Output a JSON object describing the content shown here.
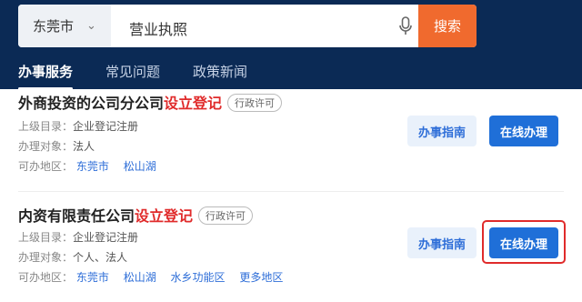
{
  "search": {
    "city": "东莞市",
    "query": "营业执照",
    "button": "搜索"
  },
  "tabs": [
    {
      "label": "办事服务"
    },
    {
      "label": "常见问题"
    },
    {
      "label": "政策新闻"
    }
  ],
  "results": [
    {
      "title_main": "外商投资的公司分公司",
      "title_highlight": "设立登记",
      "badge": "行政许可",
      "catalog_label": "上级目录：",
      "catalog_value": "企业登记注册",
      "target_label": "办理对象：",
      "target_value": "法人",
      "area_label": "可办地区：",
      "areas": [
        "东莞市",
        "松山湖"
      ],
      "guide_button": "办事指南",
      "online_button": "在线办理"
    },
    {
      "title_main": "内资有限责任公司",
      "title_highlight": "设立登记",
      "badge": "行政许可",
      "catalog_label": "上级目录：",
      "catalog_value": "企业登记注册",
      "target_label": "办理对象：",
      "target_value": "个人、法人",
      "area_label": "可办地区：",
      "areas": [
        "东莞市",
        "松山湖",
        "水乡功能区",
        "更多地区"
      ],
      "guide_button": "办事指南",
      "online_button": "在线办理"
    }
  ]
}
